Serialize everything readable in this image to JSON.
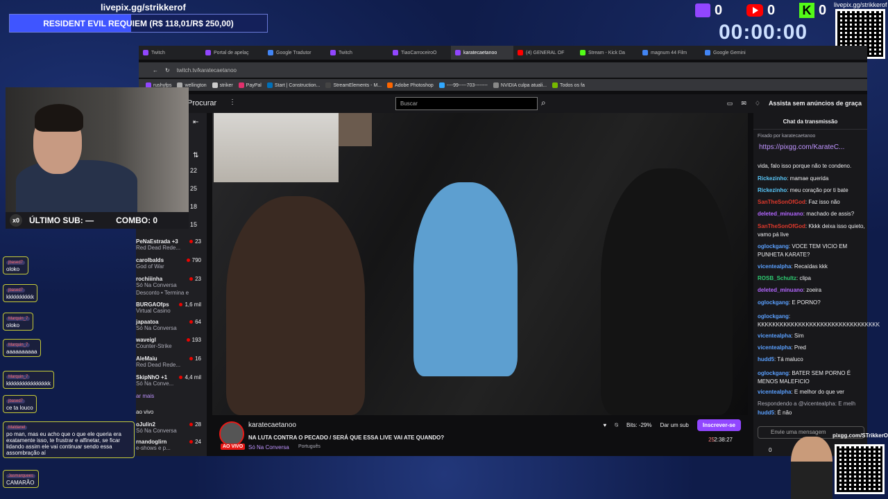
{
  "overlay": {
    "pix_url": "livepix.gg/strikkerof",
    "goal_text": "RESIDENT EVIL REQUIEM (R$ 118,01/R$ 250,00)",
    "goal_fraction": 0.472,
    "twitch_count": "0",
    "youtube_count": "0",
    "kick_count": "0",
    "timer": "00:00:00",
    "qr_label": "livepix.gg/strikkerof",
    "qr2_label": "pixgg.com/STrikkerOf",
    "last_sub_count": "x0",
    "last_sub_label": "ÚLTIMO SUB: —",
    "combo_label": "COMBO: 0"
  },
  "browser": {
    "tabs": [
      {
        "label": "Twitch",
        "color": "#9146ff"
      },
      {
        "label": "Portal de apelaç",
        "color": "#9146ff"
      },
      {
        "label": "Google Tradutor",
        "color": "#4285f4"
      },
      {
        "label": "Twitch",
        "color": "#9146ff"
      },
      {
        "label": "TiaoCarroceiroO",
        "color": "#9146ff"
      },
      {
        "label": "karatecaetanoo",
        "color": "#9146ff"
      },
      {
        "label": "(4) GENERAL OF",
        "color": "#ff0000"
      },
      {
        "label": "Stream - Kick Da",
        "color": "#53fc18"
      },
      {
        "label": "magnum 44 Film",
        "color": "#4285f4"
      },
      {
        "label": "Google Gemini",
        "color": "#4285f4"
      }
    ],
    "url": "twitch.tv/karatecaetanoo",
    "bookmarks": [
      "rushyfps",
      "wellington",
      "striker",
      "PayPal",
      "Start | Construction...",
      "StreamElements - M...",
      "Adobe Photoshop",
      "----99-----703--------",
      "NVIDIA culpa atuali...",
      "Todos os fa"
    ]
  },
  "twitch": {
    "browse": "Procurar",
    "search_placeholder": "Buscar",
    "ad_free": "Assista sem anúncios de graça",
    "side_channels": [
      {
        "name": "PeNaEstrada +3",
        "game": "Red Dead Rede...",
        "viewers": "23"
      },
      {
        "name": "carolbalds",
        "game": "God of War",
        "viewers": "790"
      },
      {
        "name": "rochiiinha",
        "game": "Só Na Conversa",
        "viewers": "23"
      },
      {
        "name": "",
        "game": "Desconto • Termina e",
        "viewers": ""
      },
      {
        "name": "BURGAOfps",
        "game": "Virtual Casino",
        "viewers": "1,6 mil"
      },
      {
        "name": "japaatoa",
        "game": "Só Na Conversa",
        "viewers": "64"
      },
      {
        "name": "waveigl",
        "game": "Counter-Strike",
        "viewers": "193"
      },
      {
        "name": "AleMaiu",
        "game": "Red Dead Rede...",
        "viewers": "16"
      },
      {
        "name": "SkipNhO +1",
        "game": "Só Na Conve...",
        "viewers": "4,4 mil"
      }
    ],
    "side_numbers": [
      "22",
      "25",
      "18",
      "15"
    ],
    "side_more": "ar mais",
    "side_live_section": "ao vivo",
    "side_channels2": [
      {
        "name": "oJulin2",
        "game": "Só Na Conversa",
        "viewers": "28"
      },
      {
        "name": "rnandoglirn",
        "game": "e-shows e p...",
        "viewers": "24"
      }
    ],
    "channel_name": "karatecaetanoo",
    "live_badge": "AO VIVO",
    "stream_title": "NA LUTA CONTRA O PECADO / SERÁ QUE ESSA LIVE VAI ATE QUANDO?",
    "category": "Só Na Conversa",
    "language": "Português",
    "bits": "Bits: -29%",
    "gift_sub": "Dar um sub",
    "subscribe": "Inscrever-se",
    "viewers": "25",
    "uptime": "2:38:27"
  },
  "chat": {
    "header": "Chat da transmissão",
    "pinned_by": "Fixado por  karatecaetanoo",
    "pinned_link": "https://pixgg.com/KarateC...",
    "messages": [
      {
        "user": "",
        "color": "#efeff1",
        "text": "vida, falo isso porque não te condeno."
      },
      {
        "user": "Rickezinho",
        "color": "#5ac8fa",
        "text": "mamae querida"
      },
      {
        "user": "Rickezinho",
        "color": "#5ac8fa",
        "text": "meu coração por ti bate"
      },
      {
        "user": "SanTheSonOfGod",
        "color": "#e0392c",
        "text": "Faz isso não"
      },
      {
        "user": "deleted_minuano",
        "color": "#b366ff",
        "text": "machado de assis?"
      },
      {
        "user": "SanTheSonOfGod",
        "color": "#e0392c",
        "text": "Kkkk deixa isso quieto, vamo pá live"
      },
      {
        "user": "oglockgang",
        "color": "#5aa0ff",
        "text": "VOCE TEM VICIO EM PUNHETA KARATE?"
      },
      {
        "user": "vicentealpha",
        "color": "#5aa0ff",
        "text": "Recaídas kkk"
      },
      {
        "user": "ROSB_Schultz",
        "color": "#2ecc71",
        "text": "clipa"
      },
      {
        "user": "deleted_minuano",
        "color": "#b366ff",
        "text": "zoeira"
      },
      {
        "user": "oglockgang",
        "color": "#5aa0ff",
        "text": "E PORNO?"
      },
      {
        "user": "oglockgang",
        "color": "#5aa0ff",
        "text": "KKKKKKKKKKKKKKKKKKKKKKKKKKKKKKKKK"
      },
      {
        "user": "vicentealpha",
        "color": "#5aa0ff",
        "text": "Sim"
      },
      {
        "user": "vicentealpha",
        "color": "#5aa0ff",
        "text": "Pred"
      },
      {
        "user": "hudd5",
        "color": "#5aa0ff",
        "text": "Tá maluco"
      },
      {
        "user": "oglockgang",
        "color": "#5aa0ff",
        "text": "BATER SEM PORNO É MENOS MALEFICIO"
      },
      {
        "user": "vicentealpha",
        "color": "#5aa0ff",
        "text": "E melhor do que ver"
      },
      {
        "user": "",
        "color": "#adadb8",
        "text": "Respondendo a @vicentealpha: E melh"
      },
      {
        "user": "hudd5",
        "color": "#5aa0ff",
        "text": "É não"
      }
    ],
    "input_placeholder": "Envie uma mensagem",
    "points": "0"
  },
  "overlay_chat": [
    {
      "user": "jbased7",
      "text": "oloko"
    },
    {
      "user": "jbased7",
      "text": "kkkkkkkkkk"
    },
    {
      "user": "Marquin_7",
      "text": "oloko"
    },
    {
      "user": "Marquin_7",
      "text": "aaaaaaaaaa"
    },
    {
      "user": "Marquin_7",
      "text": "kkkkkkkkkkkkkkkk"
    },
    {
      "user": "jbased7",
      "text": "ce ta louco"
    },
    {
      "user": "Maldanel",
      "text": "po man, mas eu acho que o que ele queria era exatamente isso, te frustrar e alfinetar, se ficar lidando assim ele vai continuar sendo essa assombração aí"
    },
    {
      "user": "Jasmarquees",
      "text": "CAMARÃO"
    }
  ]
}
